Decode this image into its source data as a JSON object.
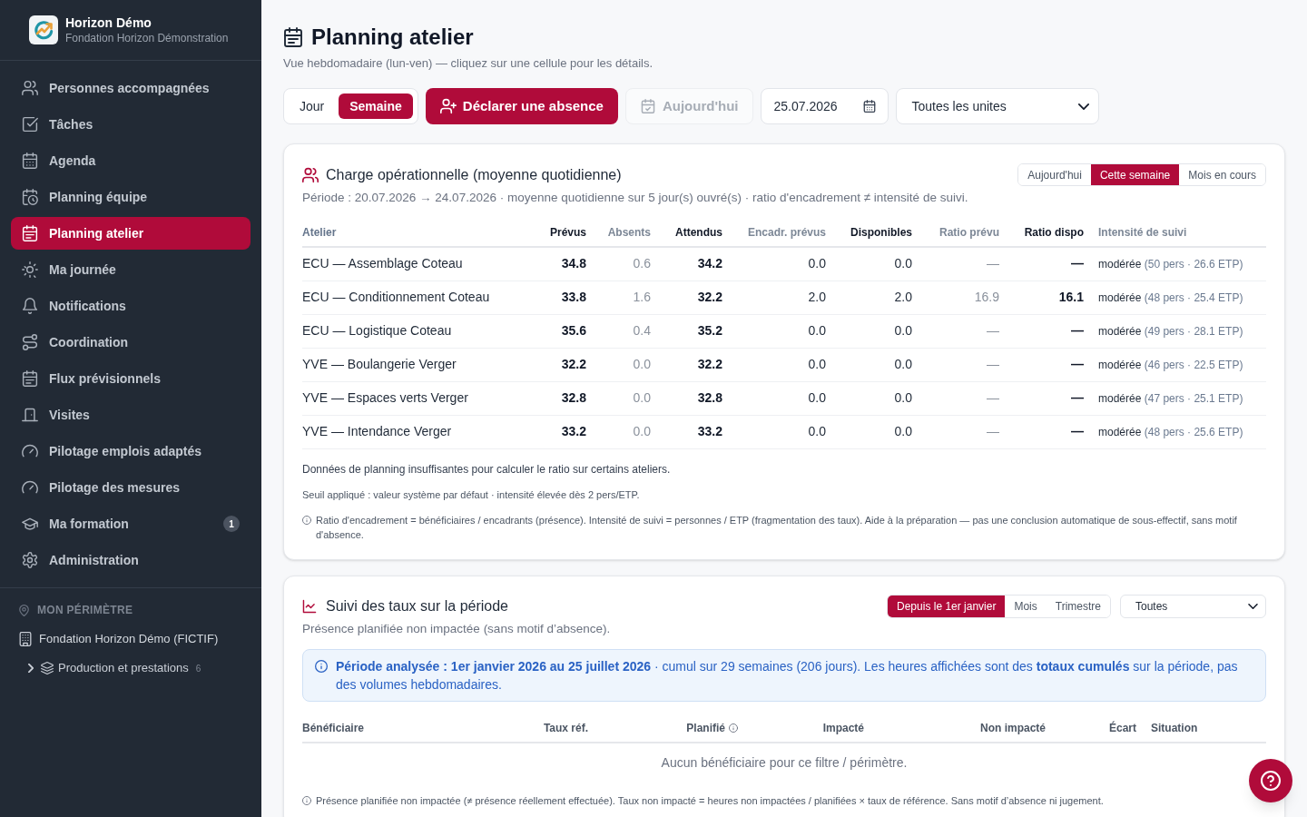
{
  "sidebar": {
    "brand": {
      "title": "Horizon Démo",
      "subtitle": "Fondation Horizon Démonstration"
    },
    "items": [
      {
        "label": "Personnes accompagnées",
        "selected": false
      },
      {
        "label": "Tâches",
        "selected": false
      },
      {
        "label": "Agenda",
        "selected": false
      },
      {
        "label": "Planning équipe",
        "selected": false
      },
      {
        "label": "Planning atelier",
        "selected": true
      },
      {
        "label": "Ma journée",
        "selected": false
      },
      {
        "label": "Notifications",
        "selected": false
      },
      {
        "label": "Coordination",
        "selected": false
      },
      {
        "label": "Flux prévisionnels",
        "selected": false
      },
      {
        "label": "Visites",
        "selected": false
      },
      {
        "label": "Pilotage emplois adaptés",
        "selected": false
      },
      {
        "label": "Pilotage des mesures",
        "selected": false
      },
      {
        "label": "Ma formation",
        "selected": false,
        "badge": "1"
      },
      {
        "label": "Administration",
        "selected": false
      }
    ],
    "scope": {
      "heading": "MON PÉRIMÈTRE",
      "organization": "Fondation Horizon Démo (FICTIF)",
      "units": [
        {
          "label": "Production et prestations",
          "count": "6",
          "expanded": false
        }
      ]
    }
  },
  "page": {
    "title": "Planning atelier",
    "subtitle": "Vue hebdomadaire (lun-ven) — cliquez sur une cellule pour les détails."
  },
  "toolbar": {
    "view_modes": [
      {
        "label": "Jour",
        "selected": false
      },
      {
        "label": "Semaine",
        "selected": true
      }
    ],
    "declare_button": "Déclarer une absence",
    "today_button": {
      "label": "Aujourd'hui",
      "disabled": true
    },
    "date_field": {
      "value": "25.07.2026"
    },
    "unit_select": {
      "value": "Toutes les unites"
    }
  },
  "workload_card": {
    "title": "Charge opérationnelle (moyenne quotidienne)",
    "period": "Période : 20.07.2026 → 24.07.2026 · moyenne quotidienne sur 5 jour(s) ouvré(s) · ratio d'encadrement ≠ intensité de suivi.",
    "ranges": [
      {
        "label": "Aujourd'hui",
        "selected": false
      },
      {
        "label": "Cette semaine",
        "selected": true
      },
      {
        "label": "Mois en cours",
        "selected": false
      }
    ],
    "table": {
      "columns": [
        {
          "label": "Atelier",
          "kind": "name"
        },
        {
          "label": "Prévus",
          "kind": "key"
        },
        {
          "label": "Absents",
          "kind": "muted"
        },
        {
          "label": "Attendus",
          "kind": "key"
        },
        {
          "label": "Encadr. prévus",
          "kind": "plain"
        },
        {
          "label": "Disponibles",
          "kind": "total"
        },
        {
          "label": "Ratio prévu",
          "kind": "muted"
        },
        {
          "label": "Ratio dispo",
          "kind": "key"
        },
        {
          "label": "Intensité de suivi",
          "kind": "intensity"
        }
      ],
      "rows": [
        {
          "cells": [
            "ECU — Assemblage Coteau",
            "34.8",
            "0.6",
            "34.2",
            "0.0",
            "0.0",
            "—",
            "—"
          ],
          "intensity": {
            "grade": "modérée",
            "detail": "(50 pers · 26.6 ETP)"
          }
        },
        {
          "cells": [
            "ECU — Conditionnement Coteau",
            "33.8",
            "1.6",
            "32.2",
            "2.0",
            "2.0",
            "16.9",
            "16.1"
          ],
          "intensity": {
            "grade": "modérée",
            "detail": "(48 pers · 25.4 ETP)"
          }
        },
        {
          "cells": [
            "ECU — Logistique Coteau",
            "35.6",
            "0.4",
            "35.2",
            "0.0",
            "0.0",
            "—",
            "—"
          ],
          "intensity": {
            "grade": "modérée",
            "detail": "(49 pers · 28.1 ETP)"
          }
        },
        {
          "cells": [
            "YVE — Boulangerie Verger",
            "32.2",
            "0.0",
            "32.2",
            "0.0",
            "0.0",
            "—",
            "—"
          ],
          "intensity": {
            "grade": "modérée",
            "detail": "(46 pers · 22.5 ETP)"
          }
        },
        {
          "cells": [
            "YVE — Espaces verts Verger",
            "32.8",
            "0.0",
            "32.8",
            "0.0",
            "0.0",
            "—",
            "—"
          ],
          "intensity": {
            "grade": "modérée",
            "detail": "(47 pers · 25.1 ETP)"
          }
        },
        {
          "cells": [
            "YVE — Intendance Verger",
            "33.2",
            "0.0",
            "33.2",
            "0.0",
            "0.0",
            "—",
            "—"
          ],
          "intensity": {
            "grade": "modérée",
            "detail": "(48 pers · 25.6 ETP)"
          }
        }
      ]
    },
    "notes": [
      {
        "kind": "notice",
        "text": "Données de planning insuffisantes pour calculer le ratio sur certains ateliers."
      },
      {
        "kind": "threshold",
        "text": "Seuil appliqué : valeur système par défaut · intensité élevée dès 2 pers/ETP."
      },
      {
        "kind": "info",
        "text": "Ratio d'encadrement = bénéficiaires / encadrants (présence). Intensité de suivi = personnes / ETP (fragmentation des taux). Aide à la préparation — pas une conclusion automatique de sous-effectif, sans motif d'absence."
      }
    ]
  },
  "rates_card": {
    "title": "Suivi des taux sur la période",
    "subtitle": "Présence planifiée non impactée (sans motif d’absence).",
    "periods": [
      {
        "label": "Depuis le 1er janvier",
        "selected": true
      },
      {
        "label": "Mois",
        "selected": false
      },
      {
        "label": "Trimestre",
        "selected": false
      }
    ],
    "filter_select": {
      "value": "Toutes"
    },
    "banner": "**Période analysée : 1er janvier 2026 au 25 juillet 2026** · cumul sur 29 semaines (206 jours). Les heures affichées sont des **totaux cumulés** sur la période, pas des volumes hebdomadaires.",
    "table": {
      "columns": [
        {
          "label": "Bénéficiaire",
          "kind": "text",
          "info": false
        },
        {
          "label": "Taux réf.",
          "kind": "number",
          "info": false
        },
        {
          "label": "Planifié",
          "kind": "number",
          "info": true
        },
        {
          "label": "Impacté",
          "kind": "number",
          "info": false
        },
        {
          "label": "Non impacté",
          "kind": "number",
          "info": false
        },
        {
          "label": "Écart",
          "kind": "number",
          "info": false
        },
        {
          "label": "Situation",
          "kind": "text",
          "info": false
        }
      ],
      "empty_message": "Aucun bénéficiaire pour ce filtre / périmètre."
    },
    "footnote": "Présence planifiée non impactée (≠ présence réellement effectuée). Taux non impacté = heures non impactées / planifiées × taux de référence. Sans motif d’absence ni jugement."
  }
}
